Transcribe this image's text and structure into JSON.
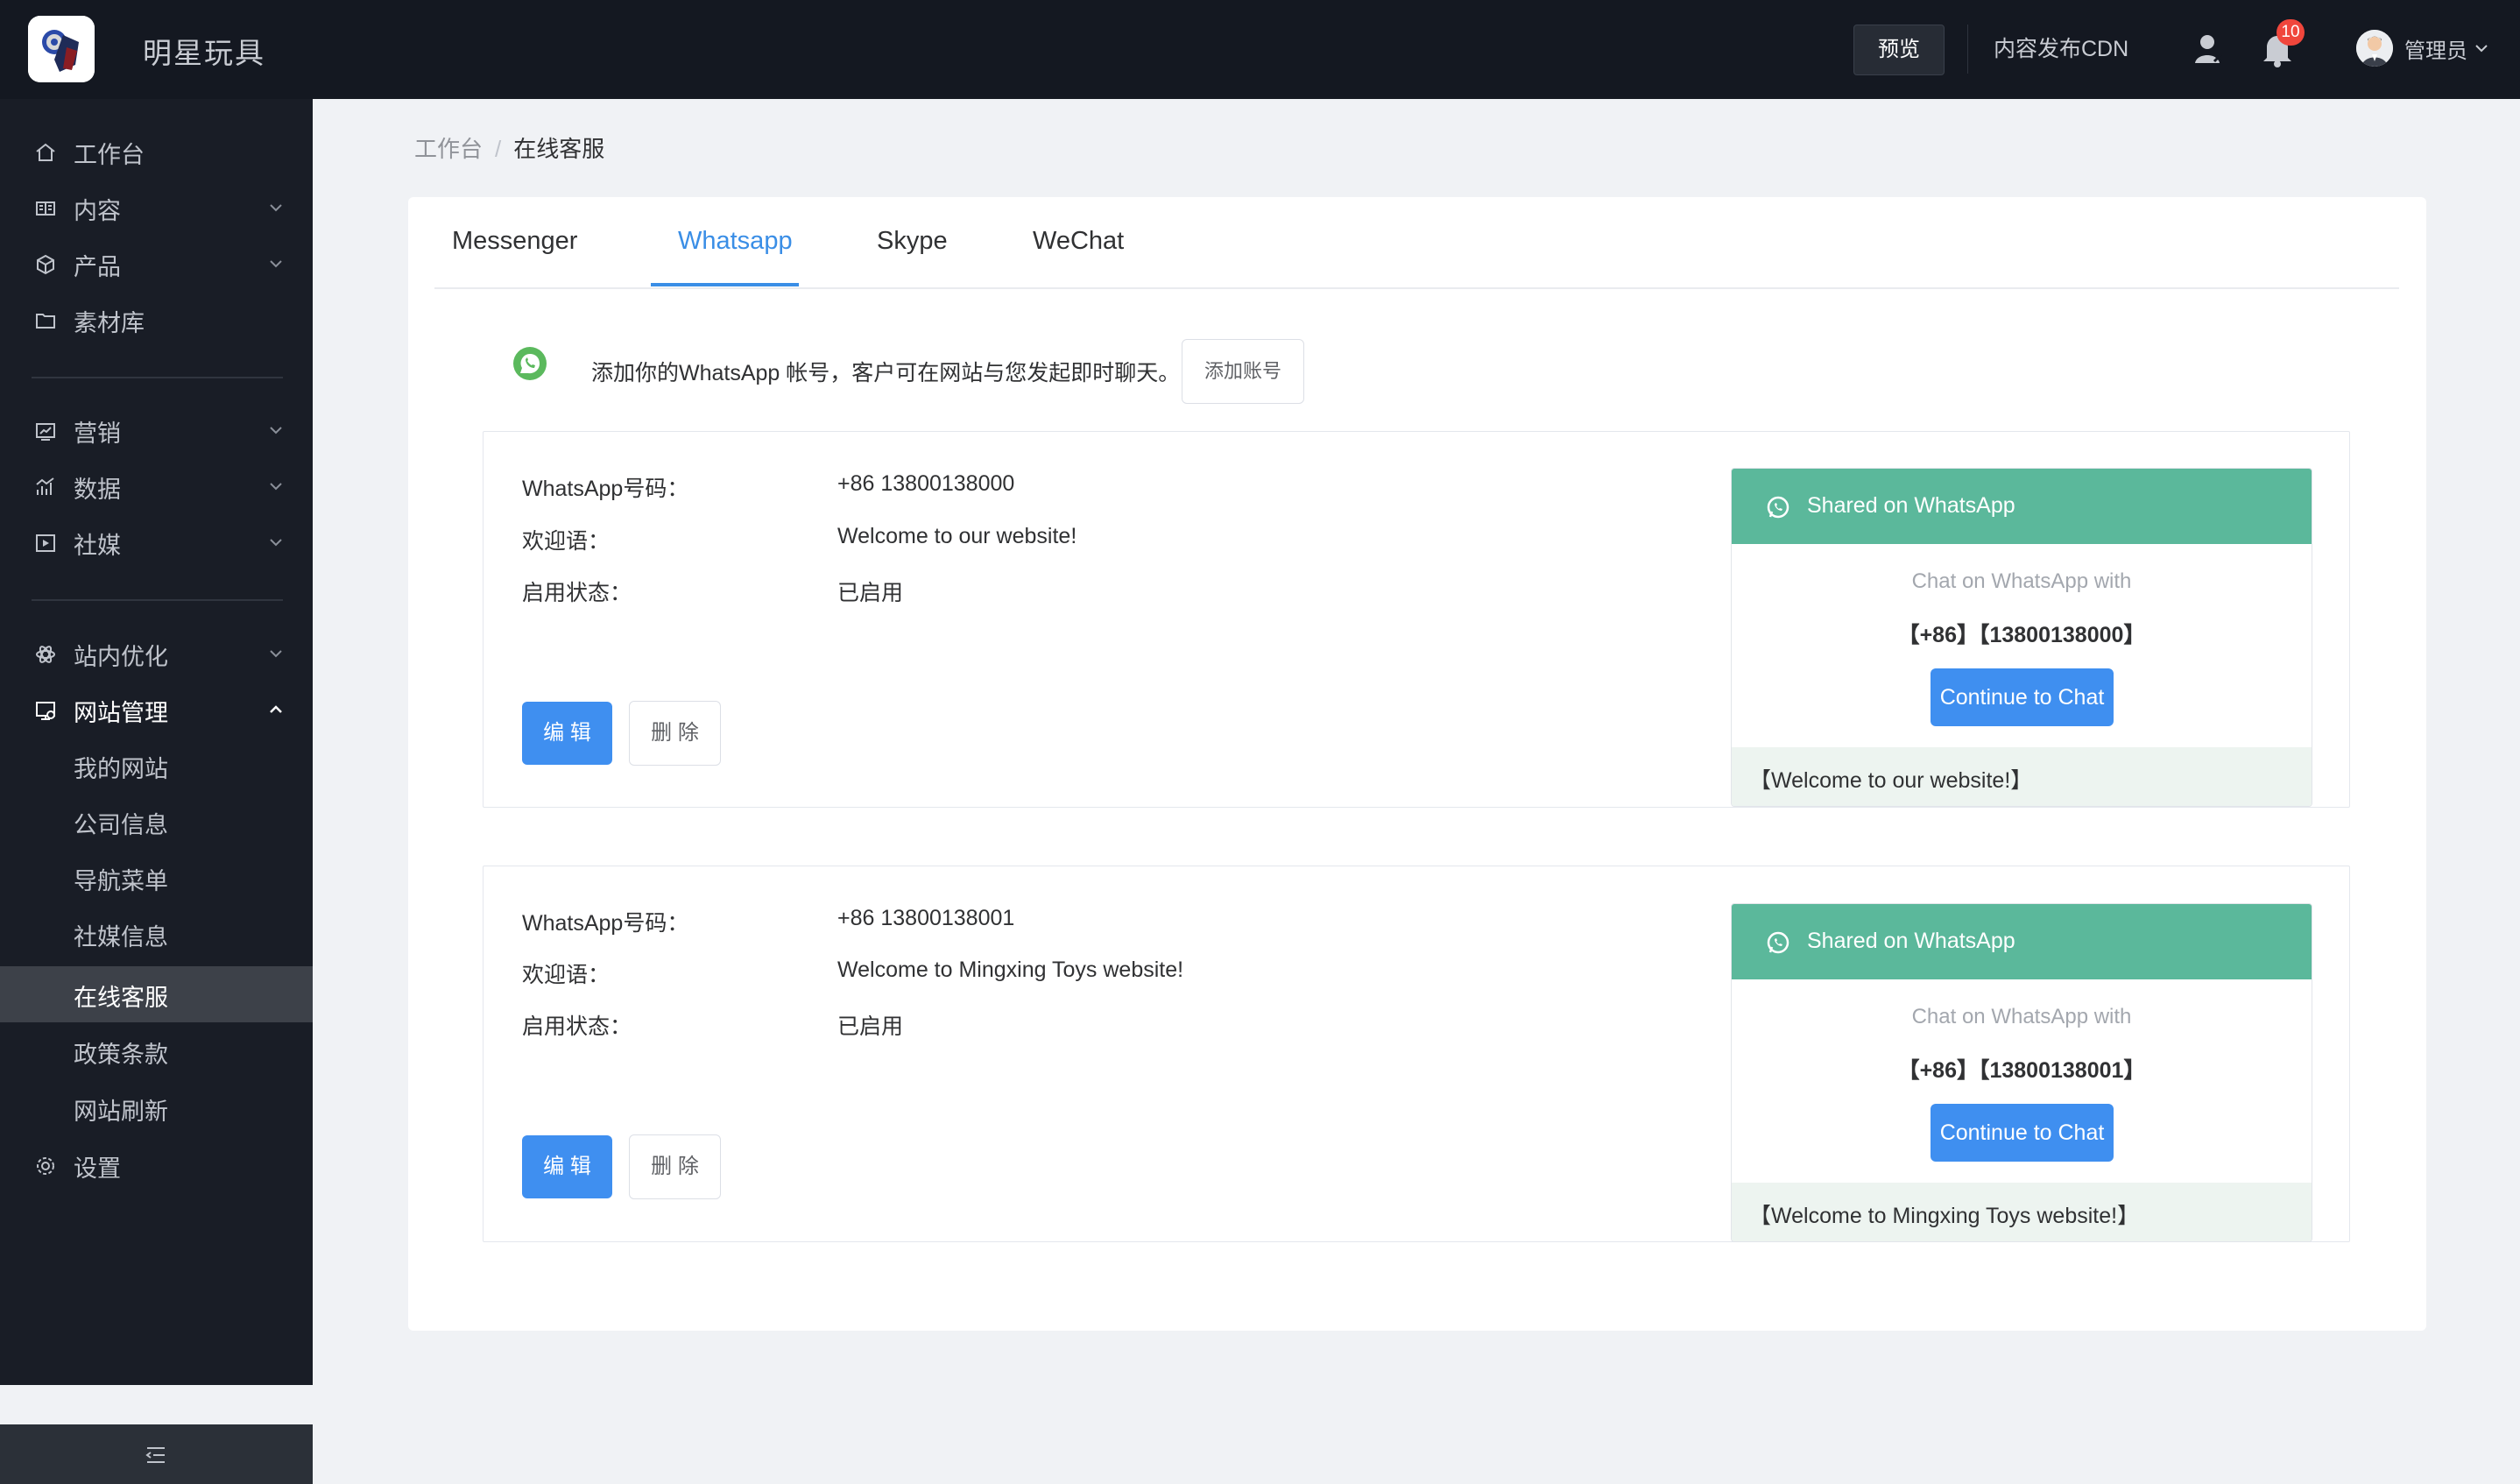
{
  "header": {
    "brand": "明星玩具",
    "preview": "预览",
    "cdn": "内容发布CDN",
    "notification_count": "10",
    "admin": "管理员"
  },
  "sidebar": {
    "items": [
      {
        "label": "工作台",
        "icon": "home-icon"
      },
      {
        "label": "内容",
        "icon": "content-icon"
      },
      {
        "label": "产品",
        "icon": "product-icon"
      },
      {
        "label": "素材库",
        "icon": "folder-icon"
      },
      {
        "label": "营销",
        "icon": "marketing-icon"
      },
      {
        "label": "数据",
        "icon": "chart-icon"
      },
      {
        "label": "社媒",
        "icon": "social-icon"
      },
      {
        "label": "站内优化",
        "icon": "optimize-icon"
      },
      {
        "label": "网站管理",
        "icon": "site-icon"
      },
      {
        "label": "设置",
        "icon": "gear-icon"
      }
    ],
    "sub_items": [
      "我的网站",
      "公司信息",
      "导航菜单",
      "社媒信息",
      "在线客服",
      "政策条款",
      "网站刷新"
    ]
  },
  "breadcrumb": {
    "root": "工作台",
    "sep": "/",
    "current": "在线客服"
  },
  "tabs": [
    "Messenger",
    "Whatsapp",
    "Skype",
    "WeChat"
  ],
  "intro": {
    "text": "添加你的WhatsApp 帐号，客户可在网站与您发起即时聊天。",
    "add_button": "添加账号"
  },
  "labels": {
    "number": "WhatsApp号码：",
    "welcome": "欢迎语：",
    "status": "启用状态：",
    "edit": "编 辑",
    "delete": "删 除"
  },
  "accounts": [
    {
      "number": "+86 13800138000",
      "welcome": "Welcome to our website!",
      "status": "已启用",
      "preview": {
        "header": "Shared on WhatsApp",
        "chat_with": "Chat on WhatsApp with",
        "number": "【+86】【13800138000】",
        "button": "Continue to Chat",
        "footer": "【Welcome to our website!】"
      }
    },
    {
      "number": "+86 13800138001",
      "welcome": "Welcome to Mingxing Toys website!",
      "status": "已启用",
      "preview": {
        "header": "Shared on WhatsApp",
        "chat_with": "Chat on WhatsApp with",
        "number": "【+86】【13800138001】",
        "button": "Continue to Chat",
        "footer": "【Welcome to Mingxing Toys website!】"
      }
    }
  ],
  "colors": {
    "accent": "#3f8ff0",
    "whatsapp": "#5bb89b",
    "sidebar": "#191d26",
    "topbar": "#141821"
  }
}
